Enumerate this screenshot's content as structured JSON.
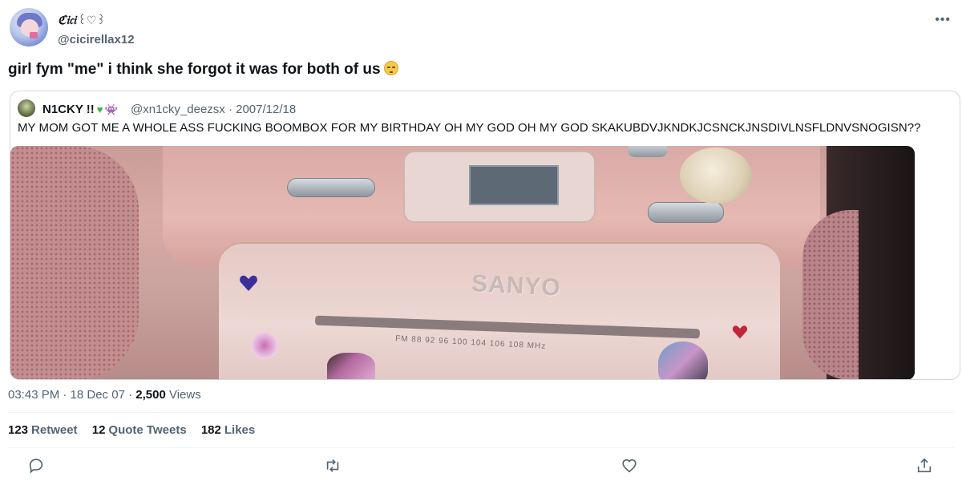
{
  "author": {
    "display_name": "ℭ𝔦𝔠𝔦",
    "display_name_deco": "꒰♡꒱",
    "handle": "@cicirellax12"
  },
  "more_icon": "more-horizontal-icon",
  "tweet": {
    "text": "girl fym \"me\" i think she forgot it was for both of us",
    "emoji": "unamused-face"
  },
  "quote": {
    "name": "N1CKY !!",
    "name_emojis": [
      "green-heart",
      "alien-monster"
    ],
    "meta": "@xn1cky_deezsx · 2007/12/18",
    "text": "MY MOM GOT ME A WHOLE ASS FUCKING BOOMBOX FOR MY BIRTHDAY OH MY GOD OH MY GOD SKAKUBDVJKNDKJCSNCKJNSDIVLNSFLDNVSNOGISN??",
    "image": {
      "brand_text": "SANYO",
      "tuner_text": "FM 88 92 96 100 104 106 108 MHz"
    }
  },
  "meta": {
    "time": "03:43 PM · 18 Dec 07 · ",
    "views_count": "2,500",
    "views_label": " Views"
  },
  "stats": {
    "retweets": {
      "count": "123",
      "label": "Retweet"
    },
    "quotes": {
      "count": "12",
      "label": "Quote Tweets"
    },
    "likes": {
      "count": "182",
      "label": "Likes"
    }
  },
  "actions": [
    "reply-icon",
    "retweet-icon",
    "like-icon",
    "share-icon"
  ],
  "colors": {
    "text_primary": "#0f1419",
    "text_secondary": "#536471",
    "border": "#cfd9de",
    "divider": "#eff3f4"
  }
}
